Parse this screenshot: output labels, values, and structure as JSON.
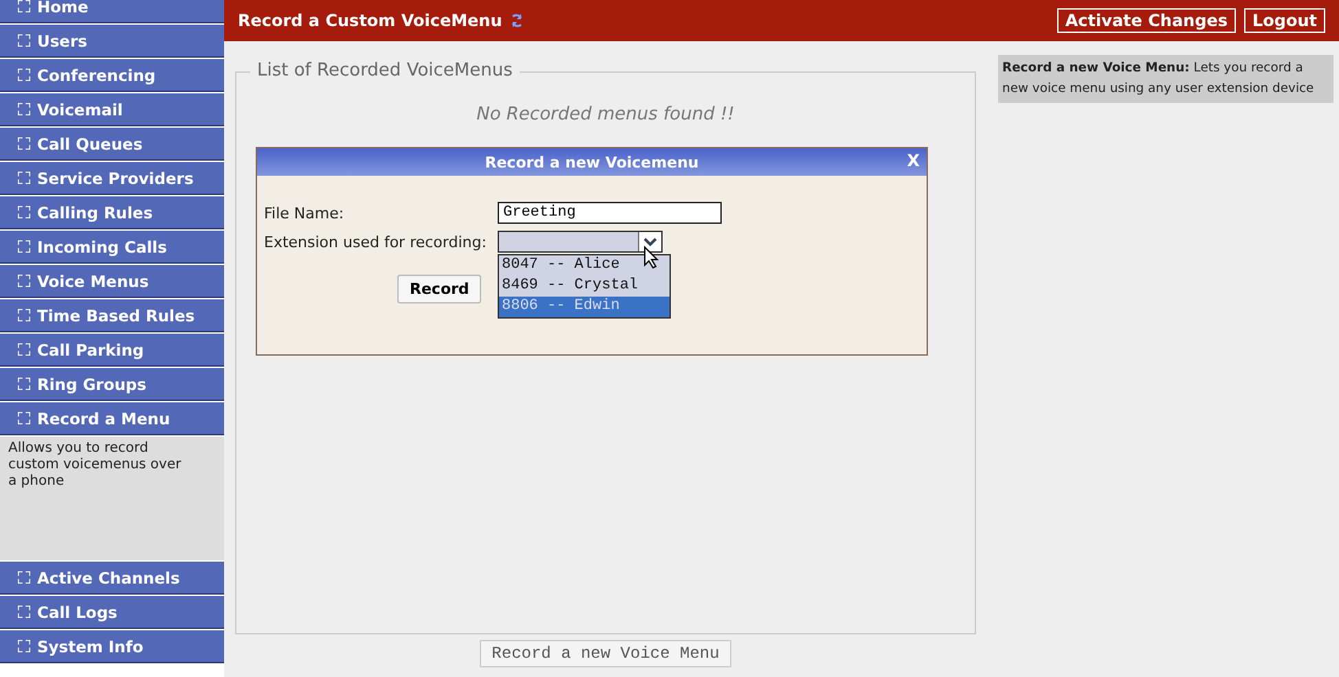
{
  "sidebar": {
    "items": [
      {
        "label": "Home"
      },
      {
        "label": "Users"
      },
      {
        "label": "Conferencing"
      },
      {
        "label": "Voicemail"
      },
      {
        "label": "Call Queues"
      },
      {
        "label": "Service Providers"
      },
      {
        "label": "Calling Rules"
      },
      {
        "label": "Incoming Calls"
      },
      {
        "label": "Voice Menus"
      },
      {
        "label": "Time Based Rules"
      },
      {
        "label": "Call Parking"
      },
      {
        "label": "Ring Groups"
      },
      {
        "label": "Record a Menu",
        "description": "Allows you to record custom voicemenus over a phone"
      },
      {
        "label": "Active Channels"
      },
      {
        "label": "Call Logs"
      },
      {
        "label": "System Info"
      }
    ]
  },
  "header": {
    "title": "Record a Custom VoiceMenu",
    "buttons": [
      "Activate Changes",
      "Logout"
    ]
  },
  "list": {
    "legend": "List of Recorded VoiceMenus",
    "empty_message": "No Recorded menus found !!"
  },
  "dialog": {
    "title": "Record a new Voicemenu",
    "close": "X",
    "file_name": {
      "label": "File Name:",
      "value": "Greeting"
    },
    "extension": {
      "label": "Extension used for recording:",
      "options": [
        {
          "label": "8047 -- Alice",
          "selected": false
        },
        {
          "label": "8469 -- Crystal",
          "selected": false
        },
        {
          "label": "8806 -- Edwin",
          "selected": true
        }
      ]
    },
    "button": "Record"
  },
  "new_button": "Record a new Voice Menu",
  "help": "**Record a new Voice Menu:** Lets you record a new voice menu using any user extension device"
}
